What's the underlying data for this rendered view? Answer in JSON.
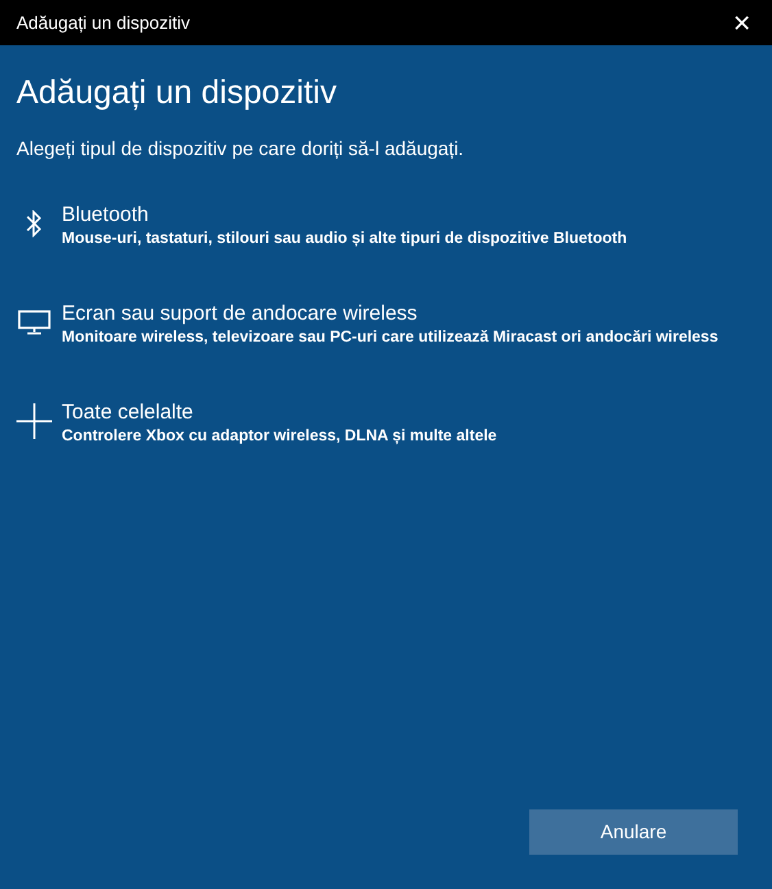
{
  "window": {
    "title": "Adăugați un dispozitiv",
    "close": "×"
  },
  "heading": "Adăugați un dispozitiv",
  "subtitle": "Alegeți tipul de dispozitiv pe care doriți să-l adăugați.",
  "devices": [
    {
      "kind": "bluetooth",
      "title": "Bluetooth",
      "description": "Mouse-uri, tastaturi, stilouri sau audio și alte tipuri de dispozitive Bluetooth"
    },
    {
      "kind": "display",
      "title": "Ecran sau suport de andocare wireless",
      "description": "Monitoare wireless, televizoare sau PC-uri care utilizează Miracast ori andocări wireless"
    },
    {
      "kind": "other",
      "title": "Toate celelalte",
      "description": "Controlere Xbox cu adaptor wireless, DLNA și multe altele"
    }
  ],
  "buttons": [
    "Anulare"
  ]
}
